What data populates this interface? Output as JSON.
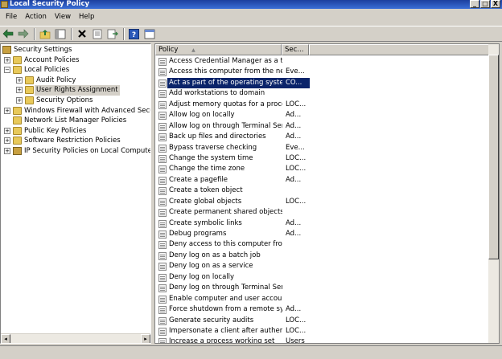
{
  "window": {
    "title": "Local Security Policy",
    "buttons": {
      "minimize": "_",
      "maximize": "□",
      "close": "X"
    }
  },
  "menu": [
    "File",
    "Action",
    "View",
    "Help"
  ],
  "toolbar": [
    "back-icon",
    "forward-icon",
    "up-folder-icon",
    "show-hide-tree-icon",
    "delete-icon",
    "properties-icon",
    "export-list-icon",
    "help-icon",
    "console-icon"
  ],
  "tree": [
    {
      "label": "Security Settings",
      "level": 0,
      "expander": "",
      "icon": "security-settings"
    },
    {
      "label": "Account Policies",
      "level": 1,
      "expander": "+",
      "icon": "folder"
    },
    {
      "label": "Local Policies",
      "level": 1,
      "expander": "−",
      "icon": "folder"
    },
    {
      "label": "Audit Policy",
      "level": 2,
      "expander": "+",
      "icon": "folder"
    },
    {
      "label": "User Rights Assignment",
      "level": 2,
      "expander": "+",
      "icon": "folder",
      "selected": true
    },
    {
      "label": "Security Options",
      "level": 2,
      "expander": "+",
      "icon": "folder"
    },
    {
      "label": "Windows Firewall with Advanced Security",
      "level": 1,
      "expander": "+",
      "icon": "folder"
    },
    {
      "label": "Network List Manager Policies",
      "level": 1,
      "expander": "",
      "icon": "folder"
    },
    {
      "label": "Public Key Policies",
      "level": 1,
      "expander": "+",
      "icon": "folder"
    },
    {
      "label": "Software Restriction Policies",
      "level": 1,
      "expander": "+",
      "icon": "folder"
    },
    {
      "label": "IP Security Policies on Local Computer",
      "level": 1,
      "expander": "+",
      "icon": "ipsec"
    }
  ],
  "list": {
    "columns": [
      "Policy",
      "Sec..."
    ],
    "rows": [
      {
        "policy": "Access Credential Manager as a tr...",
        "setting": ""
      },
      {
        "policy": "Access this computer from the net...",
        "setting": "Eve..."
      },
      {
        "policy": "Act as part of the operating system",
        "setting": "CO...",
        "selected": true
      },
      {
        "policy": "Add workstations to domain",
        "setting": ""
      },
      {
        "policy": "Adjust memory quotas for a process",
        "setting": "LOC..."
      },
      {
        "policy": "Allow log on locally",
        "setting": "Ad..."
      },
      {
        "policy": "Allow log on through Terminal Ser...",
        "setting": "Ad..."
      },
      {
        "policy": "Back up files and directories",
        "setting": "Ad..."
      },
      {
        "policy": "Bypass traverse checking",
        "setting": "Eve..."
      },
      {
        "policy": "Change the system time",
        "setting": "LOC..."
      },
      {
        "policy": "Change the time zone",
        "setting": "LOC..."
      },
      {
        "policy": "Create a pagefile",
        "setting": "Ad..."
      },
      {
        "policy": "Create a token object",
        "setting": ""
      },
      {
        "policy": "Create global objects",
        "setting": "LOC..."
      },
      {
        "policy": "Create permanent shared objects",
        "setting": ""
      },
      {
        "policy": "Create symbolic links",
        "setting": "Ad..."
      },
      {
        "policy": "Debug programs",
        "setting": "Ad..."
      },
      {
        "policy": "Deny access to this computer fro...",
        "setting": ""
      },
      {
        "policy": "Deny log on as a batch job",
        "setting": ""
      },
      {
        "policy": "Deny log on as a service",
        "setting": ""
      },
      {
        "policy": "Deny log on locally",
        "setting": ""
      },
      {
        "policy": "Deny log on through Terminal Ser...",
        "setting": ""
      },
      {
        "policy": "Enable computer and user accoun...",
        "setting": ""
      },
      {
        "policy": "Force shutdown from a remote sy...",
        "setting": "Ad..."
      },
      {
        "policy": "Generate security audits",
        "setting": "LOC..."
      },
      {
        "policy": "Impersonate a client after authen...",
        "setting": "LOC..."
      },
      {
        "policy": "Increase a process working set",
        "setting": "Users"
      }
    ]
  },
  "colors": {
    "selection": "#0a246a",
    "titlebar": "#1c3f9e",
    "chrome": "#d4d0c8"
  }
}
